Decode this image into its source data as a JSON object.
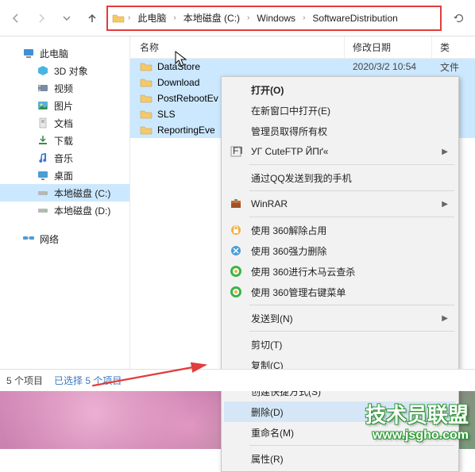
{
  "breadcrumbs": [
    "此电脑",
    "本地磁盘 (C:)",
    "Windows",
    "SoftwareDistribution"
  ],
  "columns": {
    "name": "名称",
    "date": "修改日期",
    "type": "类"
  },
  "sidebar": {
    "items": [
      {
        "label": "此电脑",
        "icon": "pc"
      },
      {
        "label": "3D 对象",
        "icon": "3d"
      },
      {
        "label": "视频",
        "icon": "video"
      },
      {
        "label": "图片",
        "icon": "pic"
      },
      {
        "label": "文档",
        "icon": "doc"
      },
      {
        "label": "下载",
        "icon": "dl"
      },
      {
        "label": "音乐",
        "icon": "music"
      },
      {
        "label": "桌面",
        "icon": "desk"
      },
      {
        "label": "本地磁盘 (C:)",
        "icon": "disk",
        "selected": true
      },
      {
        "label": "本地磁盘 (D:)",
        "icon": "disk"
      }
    ],
    "network": "网络"
  },
  "rows": [
    {
      "name": "DataStore",
      "date": "2020/3/2 10:54",
      "type": "文件"
    },
    {
      "name": "Download",
      "date": "",
      "type": "文件"
    },
    {
      "name": "PostRebootEv",
      "date": "",
      "type": "文件"
    },
    {
      "name": "SLS",
      "date": "",
      "type": "文件"
    },
    {
      "name": "ReportingEve",
      "date": "",
      "type": "文件"
    }
  ],
  "context_menu": {
    "open": "打开(O)",
    "new_window": "在新窗口中打开(E)",
    "admin_own": "管理员取得所有权",
    "cuteftp": "УГ CuteFTP ЙПґ«",
    "qq_send": "通过QQ发送到我的手机",
    "winrar": "WinRAR",
    "unlock360": "使用 360解除占用",
    "force360": "使用 360强力删除",
    "trojan360": "使用 360进行木马云查杀",
    "menu360": "使用 360管理右键菜单",
    "sendto": "发送到(N)",
    "cut": "剪切(T)",
    "copy": "复制(C)",
    "shortcut": "创建快捷方式(S)",
    "delete": "删除(D)",
    "rename": "重命名(M)",
    "props": "属性(R)"
  },
  "status": {
    "count": "5 个项目",
    "selected": "已选择 5 个项目"
  },
  "watermark": {
    "line1": "技术员联盟",
    "line2": "www.jsgho.com"
  }
}
